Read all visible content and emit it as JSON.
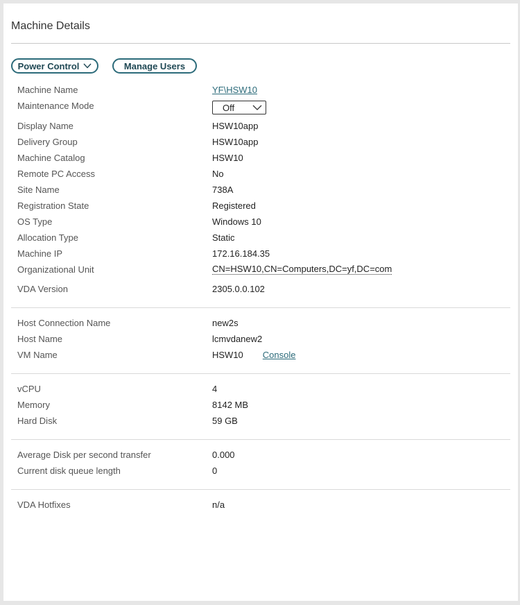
{
  "header": {
    "title": "Machine Details"
  },
  "actions": {
    "power_control": "Power Control",
    "manage_users": "Manage Users"
  },
  "details": {
    "machine_name": {
      "label": "Machine Name",
      "value": "YF\\HSW10"
    },
    "maintenance_mode": {
      "label": "Maintenance Mode",
      "value": "Off"
    },
    "display_name": {
      "label": "Display Name",
      "value": "HSW10app"
    },
    "delivery_group": {
      "label": "Delivery Group",
      "value": "HSW10app"
    },
    "machine_catalog": {
      "label": "Machine Catalog",
      "value": "HSW10"
    },
    "remote_pc_access": {
      "label": "Remote PC Access",
      "value": "No"
    },
    "site_name": {
      "label": "Site Name",
      "value": "738A"
    },
    "registration_state": {
      "label": "Registration State",
      "value": "Registered"
    },
    "os_type": {
      "label": "OS Type",
      "value": "Windows 10"
    },
    "allocation_type": {
      "label": "Allocation Type",
      "value": "Static"
    },
    "machine_ip": {
      "label": "Machine IP",
      "value": "172.16.184.35"
    },
    "organizational_unit": {
      "label": "Organizational Unit",
      "value": "CN=HSW10,CN=Computers,DC=yf,DC=com"
    },
    "vda_version": {
      "label": "VDA Version",
      "value": "2305.0.0.102"
    }
  },
  "host": {
    "host_connection_name": {
      "label": "Host Connection Name",
      "value": "new2s"
    },
    "host_name": {
      "label": "Host Name",
      "value": "lcmvdanew2"
    },
    "vm_name": {
      "label": "VM Name",
      "value": "HSW10",
      "console_link": "Console"
    }
  },
  "resources": {
    "vcpu": {
      "label": "vCPU",
      "value": "4"
    },
    "memory": {
      "label": "Memory",
      "value": "8142 MB"
    },
    "hard_disk": {
      "label": "Hard Disk",
      "value": "59 GB"
    }
  },
  "disk": {
    "avg_disk_transfer": {
      "label": "Average Disk per second transfer",
      "value": "0.000"
    },
    "disk_queue_length": {
      "label": "Current disk queue length",
      "value": "0"
    }
  },
  "hotfixes": {
    "label": "VDA Hotfixes",
    "value": "n/a"
  },
  "colors": {
    "accent": "#2c6b7a",
    "button_text": "#1f4854",
    "divider": "#d9d9d9"
  }
}
